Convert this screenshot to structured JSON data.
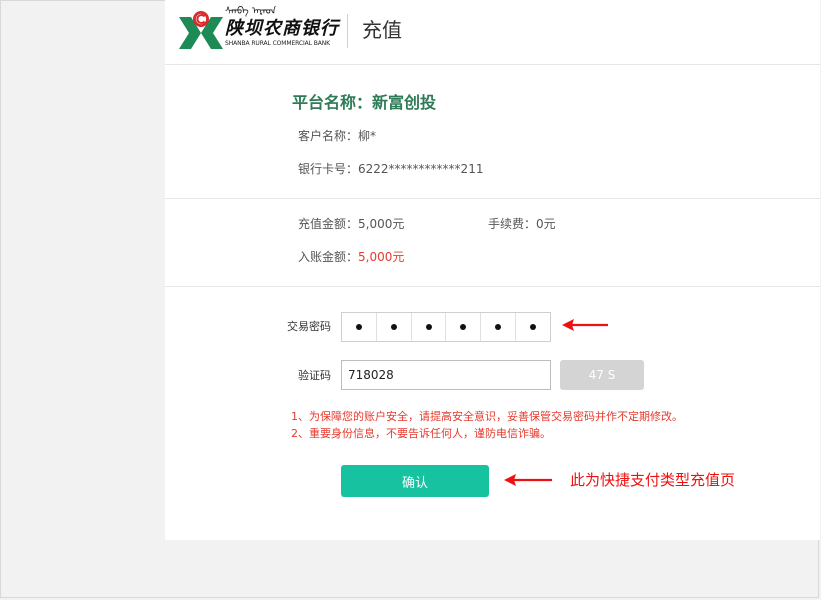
{
  "header": {
    "bank_script": "ᠱᠠᠨᠪᠠ ᠠᠷᠠᠳ",
    "bank_name_cn": "陕坝农商银行",
    "bank_name_en": "SHANBA RURAL COMMERCIAL BANK",
    "page_title": "充值"
  },
  "platform": {
    "label": "平台名称：新富创投"
  },
  "customer": {
    "name_label": "客户名称：",
    "name_value": "柳*",
    "card_label": "银行卡号：",
    "card_value": "6222************211"
  },
  "amounts": {
    "recharge_label": "充值金额：",
    "recharge_value": "5,000元",
    "fee_label": "手续费：",
    "fee_value": "0元",
    "credit_label": "入账金额：",
    "credit_value": "5,000元"
  },
  "form": {
    "password_label": "交易密码",
    "password_digits": 6,
    "code_label": "验证码",
    "code_value": "718028",
    "countdown_label": "47 S",
    "notice_1": "1、为保障您的账户安全，请提高安全意识，妥善保管交易密码并作不定期修改。",
    "notice_2": "2、重要身份信息，不要告诉任何人，谨防电信诈骗。",
    "confirm_label": "确认"
  },
  "annotation": {
    "text": "此为快捷支付类型充值页"
  },
  "colors": {
    "brand_green": "#2f7a57",
    "logo_green": "#1e8a55",
    "logo_red": "#d92b2b",
    "button_teal": "#17c2a0",
    "warning_red": "#e63a2e",
    "annotation_red": "#ee1111"
  },
  "icons": {
    "logo": "bank-logo-icon",
    "arrow": "left-arrow-icon"
  }
}
